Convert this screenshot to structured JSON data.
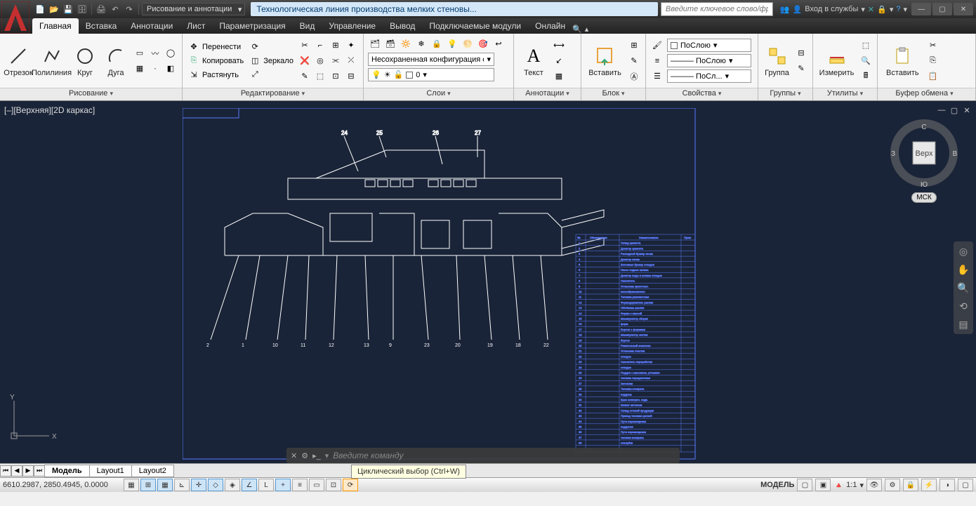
{
  "titlebar": {
    "workspace": "Рисование и аннотации",
    "doc_title": "Технологическая линия производства мелких стеновы...",
    "search_placeholder": "Введите ключевое слово/фразу",
    "login": "Вход в службы"
  },
  "ribbon": {
    "tabs": [
      "Главная",
      "Вставка",
      "Аннотации",
      "Лист",
      "Параметризация",
      "Вид",
      "Управление",
      "Вывод",
      "Подключаемые модули",
      "Онлайн"
    ],
    "active_tab": 0,
    "panels": {
      "draw": {
        "title": "Рисование",
        "line": "Отрезок",
        "polyline": "Полилиния",
        "circle": "Круг",
        "arc": "Дуга"
      },
      "edit": {
        "title": "Редактирование",
        "move": "Перенести",
        "copy": "Копировать",
        "stretch": "Растянуть",
        "rotate": "",
        "mirror": "Зеркало",
        "scale": ""
      },
      "layers": {
        "title": "Слои",
        "unsaved": "Несохраненная конфигурация сло",
        "current_layer": "0"
      },
      "annot": {
        "title": "Аннотации",
        "text": "Текст"
      },
      "block": {
        "title": "Блок",
        "insert": "Вставить"
      },
      "props": {
        "title": "Свойства",
        "bylayer": "ПоСлою",
        "bylayer2": "——— ПоСлою",
        "bylayer3": "——— ПоСл..."
      },
      "groups": {
        "title": "Группы",
        "group": "Группа"
      },
      "utils": {
        "title": "Утилиты",
        "measure": "Измерить"
      },
      "clip": {
        "title": "Буфер обмена",
        "paste": "Вставить"
      }
    }
  },
  "viewport": {
    "label": "[–][Верхняя][2D каркас]",
    "viewcube": {
      "top": "Верх",
      "n": "С",
      "s": "Ю",
      "e": "В",
      "w": "З",
      "wcs": "МСК"
    }
  },
  "spec_table": {
    "headers": [
      "№",
      "Обозначение",
      "Наименование",
      "Прим"
    ],
    "rows": [
      "Склад цемента",
      "Дозатор цемента",
      "Расходный бункер песка",
      "Дозатор песка",
      "Бетонные бункер отходов",
      "Насос подачи шлама",
      "Дозатор воды и шлама отходов",
      "Смеситель",
      "Установка приготовл.",
      "пенообразователя",
      "Тележка разливочная",
      "Формодержатель разлив",
      "Объёмная разлив",
      "Форма с массой",
      "Манипулятор сборки",
      "форм",
      "Бортов с формами",
      "Манипулятор снятия",
      "бортов",
      "Резательный комплекс",
      "Установка очистки",
      "отходов",
      "Смеситель переработки",
      "отходов",
      "Поддон с массивом, устанавл",
      "тележка передаточная",
      "Автоклав",
      "Тележка возврата",
      "поддона",
      "Кран электрич. подв.",
      "Захват автоклав",
      "Склад готовой продукции",
      "Привод тележки цепной",
      "Пути перемещения",
      "поддонов",
      "Пути перемещения",
      "тележек возврата",
      "опалубки"
    ]
  },
  "cmdline": {
    "placeholder": "Введите команду"
  },
  "tooltip": "Циклический выбор (Ctrl+W)",
  "model_tabs": [
    "Модель",
    "Layout1",
    "Layout2"
  ],
  "status": {
    "coords": "6610.2987, 2850.4945, 0.0000",
    "model": "МОДЕЛЬ",
    "scale": "1:1"
  }
}
